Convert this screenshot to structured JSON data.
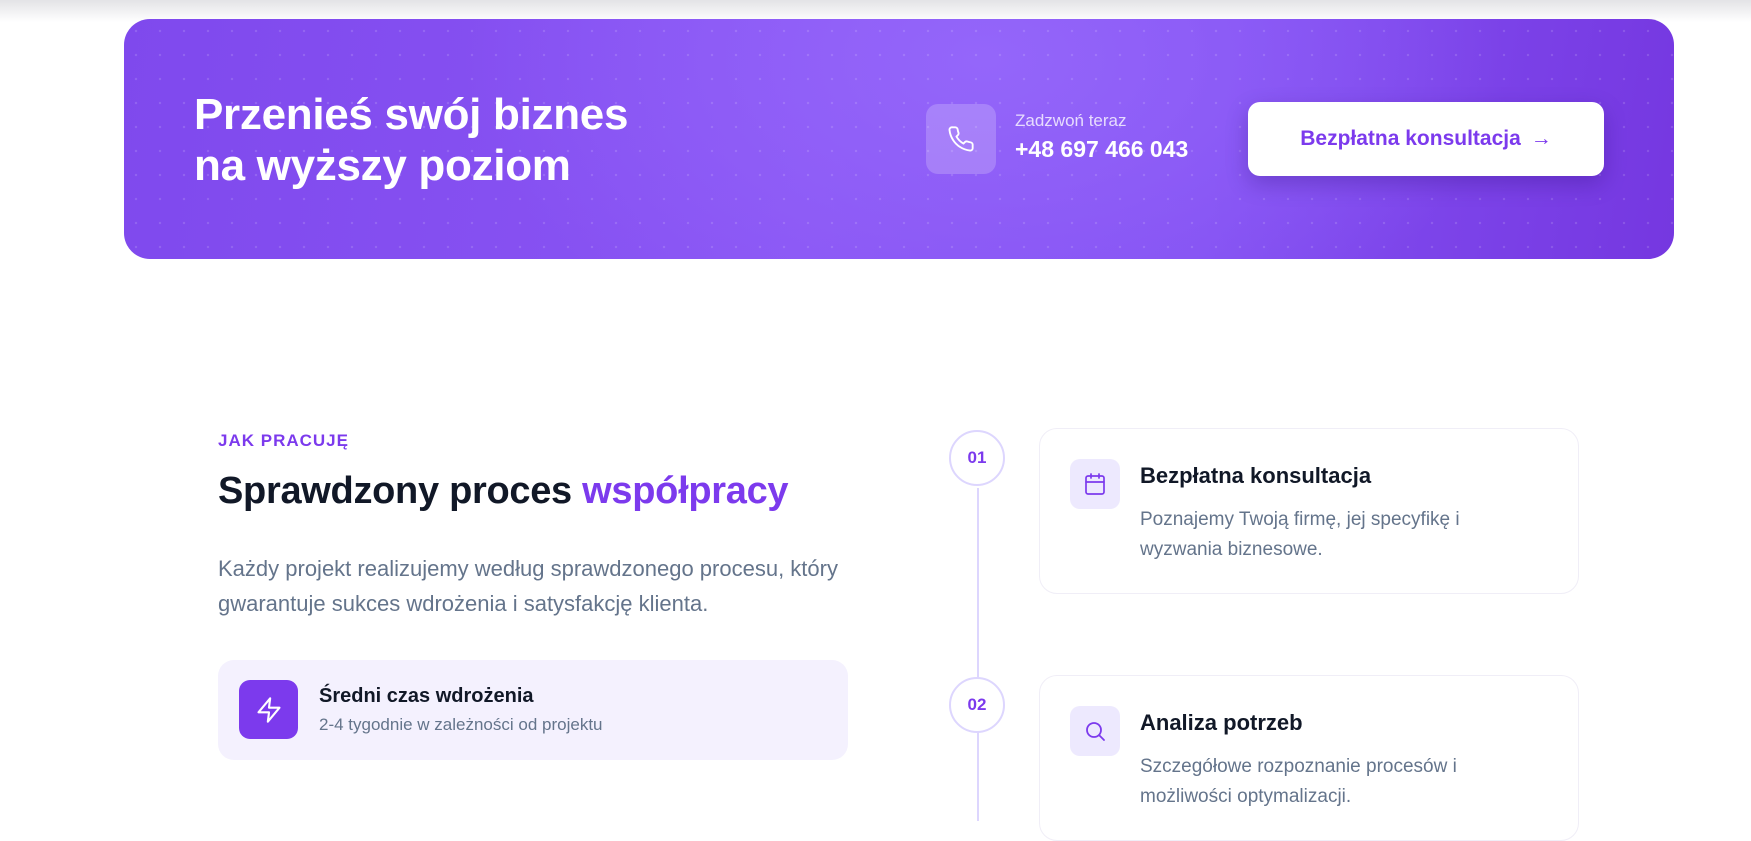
{
  "cta": {
    "title_line1": "Przenieś swój biznes",
    "title_line2": "na wyższy poziom",
    "phone_caption": "Zadzwoń teraz",
    "phone_number": "+48 697 466 043",
    "button_label": "Bezpłatna konsultacja",
    "button_arrow": "→",
    "phone_icon": "phone-icon"
  },
  "process": {
    "eyebrow": "JAK PRACUJĘ",
    "heading_plain": "Sprawdzony proces",
    "heading_accent": "współpracy",
    "lead": "Każdy projekt realizujemy według sprawdzonego procesu, który gwarantuje sukces wdrożenia i satysfakcję klienta.",
    "stat": {
      "icon": "lightning-icon",
      "title": "Średni czas wdrożenia",
      "subtitle": "2-4 tygodnie w zależności od projektu"
    },
    "steps": [
      {
        "number": "01",
        "icon": "calendar-icon",
        "title": "Bezpłatna konsultacja",
        "description": "Poznajemy Twoją firmę, jej specyfikę i wyzwania biznesowe."
      },
      {
        "number": "02",
        "icon": "search-icon",
        "title": "Analiza potrzeb",
        "description": "Szczegółowe rozpoznanie procesów i możliwości optymalizacji."
      }
    ]
  },
  "colors": {
    "accent": "#7c3aed",
    "banner": "#8350f2",
    "text_muted": "#64748b",
    "heading": "#111827"
  }
}
